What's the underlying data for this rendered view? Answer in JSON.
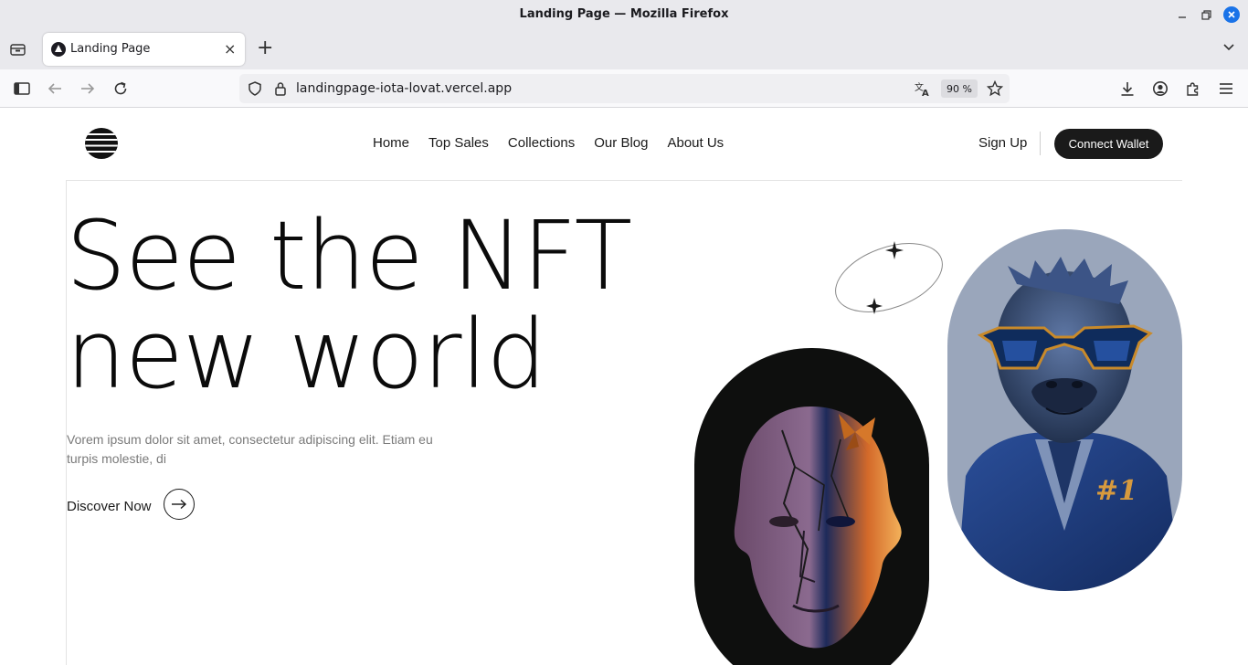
{
  "window": {
    "title": "Landing Page — Mozilla Firefox"
  },
  "tabs": [
    {
      "title": "Landing Page",
      "active": true
    }
  ],
  "toolbar": {
    "url": "landingpage-iota-lovat.vercel.app",
    "zoom": "90 %"
  },
  "site": {
    "nav": [
      "Home",
      "Top Sales",
      "Collections",
      "Our Blog",
      "About Us"
    ],
    "signup": "Sign Up",
    "connect_wallet": "Connect Wallet",
    "hero": {
      "title_line1": "See the NFT",
      "title_line2": "new world",
      "description": "Vorem ipsum dolor sit amet, consectetur adipiscing elit. Etiam eu turpis molestie, di",
      "cta": "Discover Now"
    },
    "artworks": [
      {
        "icon": "cracked-head-art-icon"
      },
      {
        "icon": "gorilla-sunglasses-art-icon",
        "badge": "#1"
      }
    ]
  },
  "colors": {
    "chrome_bg": "#e9e9ed",
    "accent": "#1a73e8",
    "button_dark": "#1a1a1a",
    "ape_bg": "#9aa6bb",
    "head_bg": "#0e0f0e"
  }
}
